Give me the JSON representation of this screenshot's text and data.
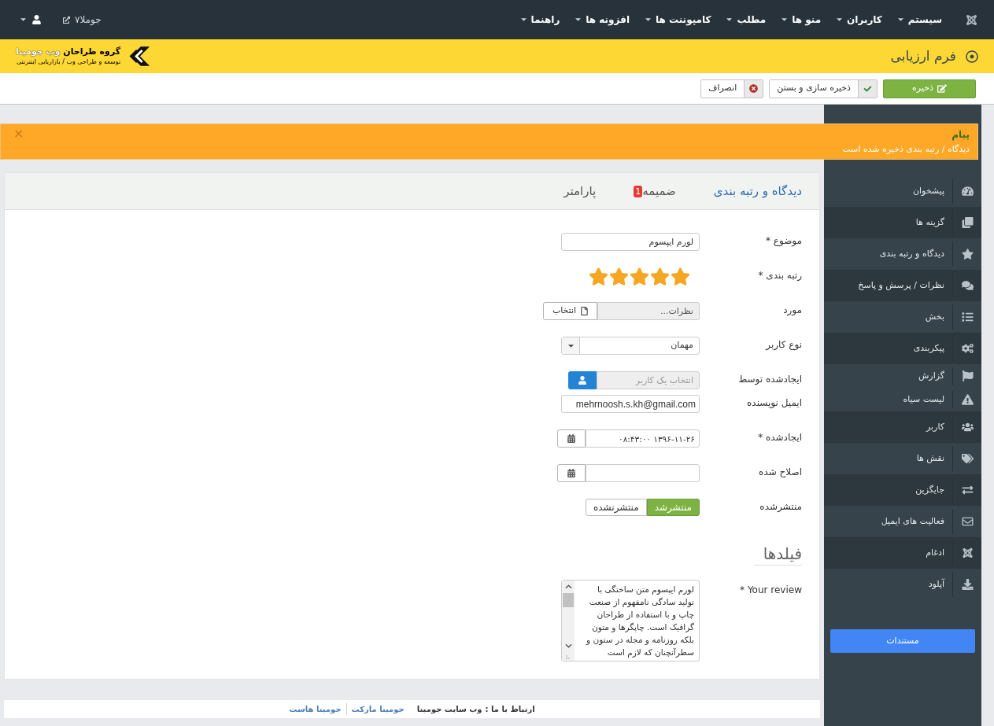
{
  "top_menu": {
    "items": [
      {
        "label": "سیستم"
      },
      {
        "label": "کاربران"
      },
      {
        "label": "منو ها"
      },
      {
        "label": "مطلب"
      },
      {
        "label": "کامپوننت ها"
      },
      {
        "label": "افزونه ها"
      },
      {
        "label": "راهنما"
      }
    ],
    "site_link": "جوملا۷"
  },
  "header": {
    "title": "فرم ارزیابی",
    "logo": {
      "title": "گروه طراحان",
      "title_accent": "وب جومینا",
      "tagline": "توسعه و طراحی وب / بازاریابی اینترنتی"
    }
  },
  "toolbar": {
    "buttons": [
      {
        "kind": "save",
        "label": "ذخیره"
      },
      {
        "kind": "save_close",
        "label": "ذخیره سازی و بستن"
      },
      {
        "kind": "cancel",
        "label": "انصراف"
      }
    ]
  },
  "alert": {
    "close": "×",
    "title": "پیام",
    "message": "دیدگاه / رتبه بندی ذخیره شده است"
  },
  "tabs": [
    {
      "label": "دیدگاه و رتبه بندی",
      "selected": true
    },
    {
      "label": "ضمیمه",
      "badge": "1",
      "selected": false
    },
    {
      "label": "پارامتر",
      "selected": false
    }
  ],
  "form": {
    "fields": [
      {
        "kind": "text",
        "label": "موضوع *",
        "value": "لورم ایپسوم"
      },
      {
        "kind": "rating",
        "label": "رتبه بندی *",
        "stars": 5
      },
      {
        "kind": "modal",
        "label": "مورد",
        "value": "نظرات...",
        "button": "انتخاب"
      },
      {
        "kind": "select",
        "label": "نوع کاربر",
        "value": "مهمان"
      },
      {
        "kind": "user",
        "label": "ایجادشده توسط",
        "placeholder": "انتخاب یک کاربر"
      },
      {
        "kind": "email",
        "label": "ایمیل نویسنده",
        "value": "mehrnoosh.s.kh@gmail.com"
      },
      {
        "kind": "calendar",
        "label": "ایجادشده *",
        "value": "۱۳۹۶-۱۱-۲۶ ۰۸:۴۳:۰۰"
      },
      {
        "kind": "calendar",
        "label": "اصلاح شده"
      },
      {
        "kind": "toggle",
        "label": "منتشرشده",
        "options": [
          {
            "label": "منتشرشد",
            "selected": true
          },
          {
            "label": "منتشرنشده",
            "selected": false
          }
        ]
      }
    ],
    "section_title": "فیلدها",
    "custom_fields": [
      {
        "kind": "textarea",
        "label": "Your review *",
        "value": "لورم ایپسوم متن ساختگی با تولید سادگی نامفهوم از صنعت چاپ و با استفاده از طراحان گرافیک است. چاپگرها و متون بلکه روزنامه و مجله در ستون و سطرآنچنان که لازم است"
      }
    ]
  },
  "sidebar": {
    "rows": [
      {
        "items": [
          {
            "label": "پیشخوان"
          }
        ]
      },
      {
        "items": [
          {
            "label": "گزینه ها"
          }
        ]
      },
      {
        "items": [
          {
            "label": "دیدگاه و رتبه بندی"
          }
        ]
      },
      {
        "items": [
          {
            "label": "نظرات / پرسش و پاسخ"
          }
        ]
      },
      {
        "items": [
          {
            "label": "بخش"
          }
        ]
      },
      {
        "items": [
          {
            "label": "پیکربندی"
          }
        ]
      },
      {
        "items": [
          {
            "label": "گزارش"
          },
          {
            "label": "لیست سیاه"
          }
        ]
      },
      {
        "items": [
          {
            "label": "کاربر"
          }
        ]
      },
      {
        "items": [
          {
            "label": "نقش ها"
          }
        ]
      },
      {
        "items": [
          {
            "label": "جایگزین"
          }
        ]
      },
      {
        "items": [
          {
            "label": "فعالیت های ایمیل"
          }
        ]
      },
      {
        "items": [
          {
            "label": "ادغام"
          }
        ]
      },
      {
        "items": [
          {
            "label": "آپلود"
          }
        ]
      }
    ],
    "button": "مستندات"
  },
  "footer": {
    "contact": "ارتباط با ما :",
    "contact_link": "وب سایت جومینا",
    "links": [
      "جومینا مارکت",
      "جومینا هاست"
    ]
  }
}
